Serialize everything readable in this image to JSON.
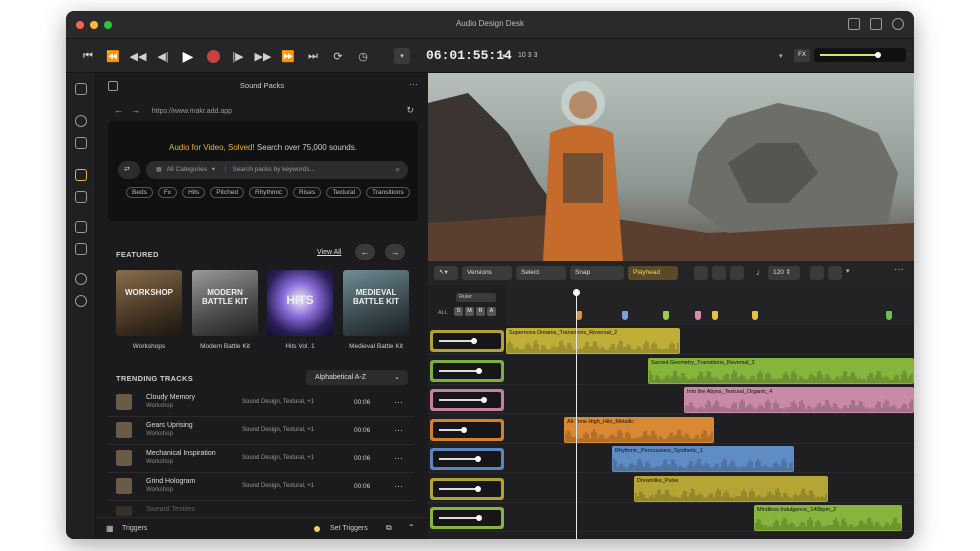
{
  "window": {
    "title": "Audio Design Desk"
  },
  "transport": {
    "timecode": "06:01:55:14",
    "sub": "10 3 3",
    "fx_label": "FX",
    "volume_level": 0.72
  },
  "panel": {
    "title": "Sound Packs",
    "url": "https://www.makr.add.app",
    "hero": {
      "title_accent": "Audio for Video, Solved!",
      "title_rest": " Search over 75,000 sounds.",
      "category": "All Categories",
      "search_placeholder": "Search packs by keywords..."
    },
    "chips": [
      "Beds",
      "Fx",
      "Hits",
      "Pitched",
      "Rhythmic",
      "Rises",
      "Textural",
      "Transitions"
    ],
    "featured": {
      "title": "FEATURED",
      "view_all": "View All",
      "cards": [
        {
          "art": "WORKSHOP",
          "label": "Workshops"
        },
        {
          "art": "MODERN BATTLE KIT",
          "label": "Modern Battle Kit"
        },
        {
          "art": "HITS",
          "label": "Hits Vol. 1"
        },
        {
          "art": "MEDIEVAL BATTLE KIT",
          "label": "Medieval Battle Kit"
        }
      ]
    },
    "trending": {
      "title": "TRENDING TRACKS",
      "sort": "Alphabetical A-Z",
      "tracks": [
        {
          "name": "Cloudy Memory",
          "pack": "Workshop",
          "tags": "Sound Design, Textural, +1",
          "dur": "00:06"
        },
        {
          "name": "Gears Uprising",
          "pack": "Workshop",
          "tags": "Sound Design, Textural, +1",
          "dur": "00:06"
        },
        {
          "name": "Mechanical Inspiration",
          "pack": "Workshop",
          "tags": "Sound Design, Textural, +1",
          "dur": "00:06"
        },
        {
          "name": "Grind Hologram",
          "pack": "Workshop",
          "tags": "Sound Design, Textural, +1",
          "dur": "00:06"
        },
        {
          "name": "Sweard Textiles",
          "pack": "",
          "tags": "",
          "dur": ""
        }
      ]
    },
    "bottom": {
      "triggers": "Triggers",
      "set_triggers": "Set Triggers"
    }
  },
  "toolbar2": {
    "versions": "Versions",
    "select": "Select",
    "snap": "Snap",
    "playhead": "Playhead",
    "bpm": "120"
  },
  "timeline": {
    "ruler_label": "Ruler",
    "all_label": "ALL",
    "track_buttons": [
      "S",
      "M",
      "R",
      "A"
    ],
    "lanes": [
      {
        "color": "#b3a032",
        "level": 0.62,
        "clip": "Supernova Dreams_Transitions_Reversal_2",
        "clip_color": "#bfae38"
      },
      {
        "color": "#7fae3c",
        "level": 0.72,
        "clip": "Sacred Geometry_Transitions_Reversal_2",
        "clip_color": "#86b43c"
      },
      {
        "color": "#c57ea0",
        "level": 0.8,
        "clip": "Into the Abyss_Textural_Organic_4",
        "clip_color": "#c98aa8"
      },
      {
        "color": "#d2802e",
        "level": 0.44,
        "clip": "All-Time High_Hits_Metallic",
        "clip_color": "#d98834"
      },
      {
        "color": "#5a86bd",
        "level": 0.7,
        "clip": "Rhythmic_Percussions_Synthetic_1",
        "clip_color": "#5f8cc4"
      },
      {
        "color": "#b3a032",
        "level": 0.7,
        "clip": "Dreamlike_Pulse",
        "clip_color": "#b4a535"
      },
      {
        "color": "#86b43c",
        "level": 0.72,
        "clip": "Mindless Indulgence_140bpm_2",
        "clip_color": "#86b43c"
      }
    ],
    "markers": [
      "#e09040",
      "#7aa0d8",
      "#9ccf4e",
      "#d88ab8",
      "#e6c040",
      "#e6c040",
      "#6cc04a"
    ]
  }
}
